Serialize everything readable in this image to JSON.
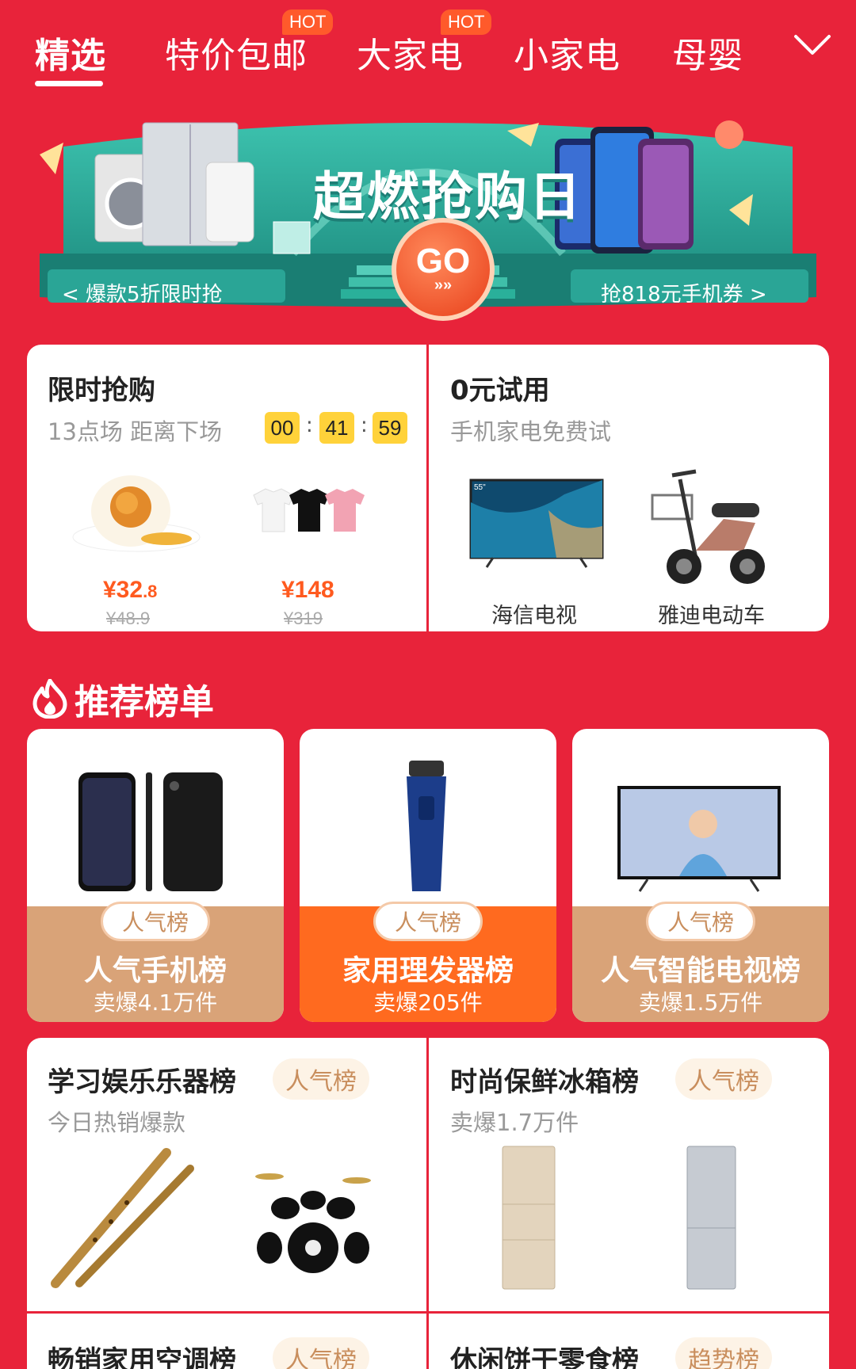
{
  "nav": {
    "tabs": [
      {
        "label": "精选",
        "hot": false
      },
      {
        "label": "特价包邮",
        "hot": true
      },
      {
        "label": "大家电",
        "hot": true
      },
      {
        "label": "小家电",
        "hot": false
      },
      {
        "label": "母婴",
        "hot": false
      }
    ],
    "hot_badge": "HOT",
    "more_icon": "chevron-down-icon"
  },
  "banner": {
    "title": "超燃抢购日",
    "go_label": "GO",
    "go_arrows": "»»",
    "left_link": "< 爆款5折限时抢",
    "right_link": "抢818元手机券 >"
  },
  "flash_sale": {
    "title": "限时抢购",
    "subtitle": "13点场 距离下场",
    "countdown": {
      "h": "00",
      "m": "41",
      "s": "59",
      "sep": ":"
    },
    "items": [
      {
        "name": "salted-egg",
        "price_main": "¥32",
        "price_dec": ".8",
        "old_price": "¥48.9"
      },
      {
        "name": "t-shirts",
        "price_main": "¥148",
        "price_dec": "",
        "old_price": "¥319"
      }
    ]
  },
  "free_trial": {
    "title": "0元试用",
    "subtitle": "手机家电免费试",
    "items": [
      {
        "label": "海信电视",
        "badge": "55\""
      },
      {
        "label": "雅迪电动车"
      }
    ]
  },
  "ranking": {
    "section_title": "推荐榜单",
    "cards": [
      {
        "badge": "人气榜",
        "name": "人气手机榜",
        "sold": "卖爆4.1万件",
        "color": "#d9a378"
      },
      {
        "badge": "人气榜",
        "name": "家用理发器榜",
        "sold": "卖爆205件",
        "color": "#ff6a1f"
      },
      {
        "badge": "人气榜",
        "name": "人气智能电视榜",
        "sold": "卖爆1.5万件",
        "color": "#d9a378"
      }
    ]
  },
  "lists": [
    {
      "title": "学习娱乐乐器榜",
      "tag": "人气榜",
      "sub": "今日热销爆款"
    },
    {
      "title": "时尚保鲜冰箱榜",
      "tag": "人气榜",
      "sub": "卖爆1.7万件"
    },
    {
      "title": "畅销家用空调榜",
      "tag": "人气榜"
    },
    {
      "title": "休闲饼干零食榜",
      "tag": "趋势榜"
    }
  ],
  "colors": {
    "background": "#e8233a",
    "accent": "#ff5a1f",
    "timer": "#ffd23a",
    "banner_teal": "#2fa99a"
  }
}
